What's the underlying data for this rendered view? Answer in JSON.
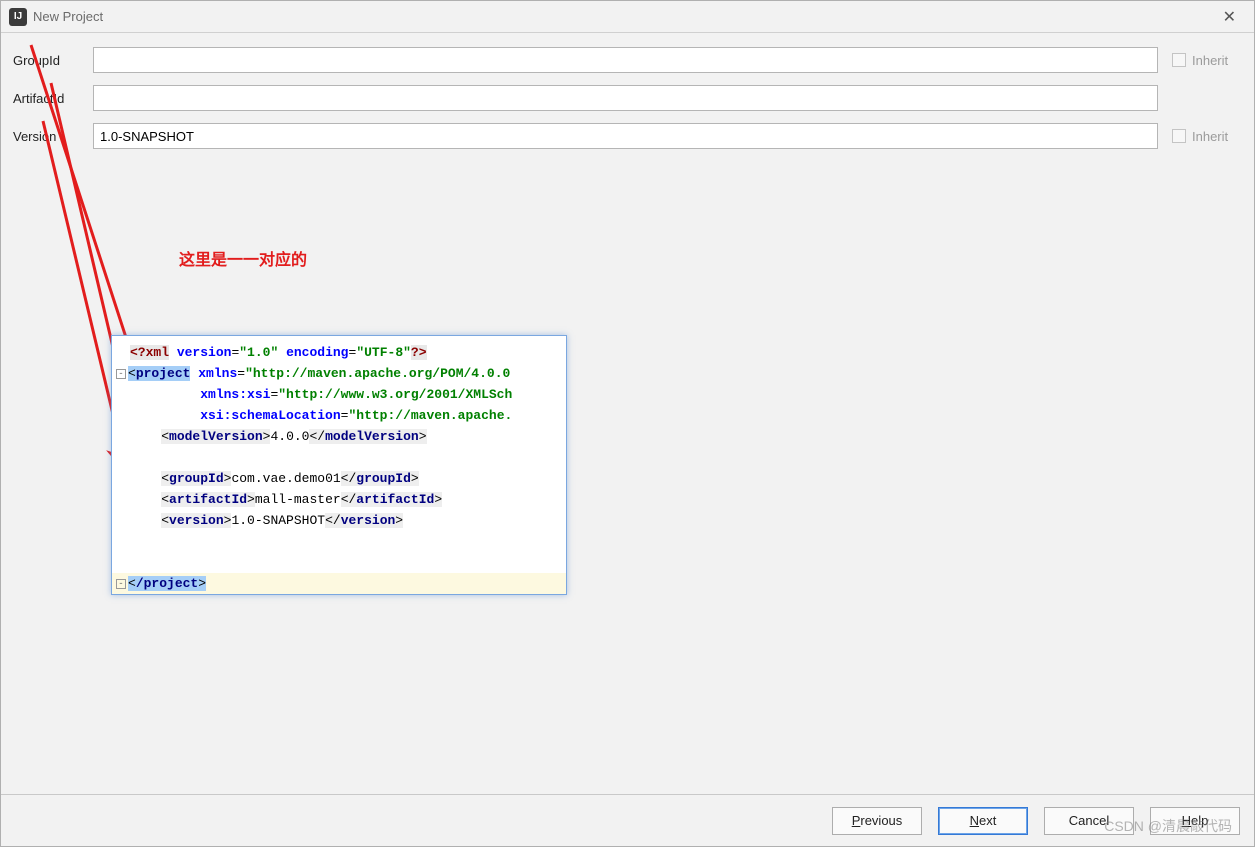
{
  "window": {
    "title": "New Project"
  },
  "form": {
    "groupId": {
      "label": "GroupId",
      "value": "",
      "inherit_label": "Inherit"
    },
    "artifactId": {
      "label": "ArtifactId",
      "value": ""
    },
    "version": {
      "label": "Version",
      "value": "1.0-SNAPSHOT",
      "inherit_label": "Inherit"
    }
  },
  "annotation": {
    "text": "这里是一一对应的"
  },
  "code": {
    "xml_decl": {
      "open": "<?xml",
      "version_k": "version",
      "version_v": "\"1.0\"",
      "encoding_k": "encoding",
      "encoding_v": "\"UTF-8\"",
      "close": "?>"
    },
    "project_open": "project",
    "xmlns_k": "xmlns",
    "xmlns_v": "\"http://maven.apache.org/POM/4.0.0",
    "xmlnsxsi_k": "xmlns:xsi",
    "xmlnsxsi_v": "\"http://www.w3.org/2001/XMLSch",
    "schemaloc_k": "xsi:schemaLocation",
    "schemaloc_v": "\"http://maven.apache.",
    "modelVersion_tag": "modelVersion",
    "modelVersion_val": "4.0.0",
    "groupId_tag": "groupId",
    "groupId_val": "com.vae.demo01",
    "artifactId_tag": "artifactId",
    "artifactId_val": "mall-master",
    "version_tag": "version",
    "version_val": "1.0-SNAPSHOT",
    "project_close": "/project"
  },
  "buttons": {
    "previous": "Previous",
    "next": "Next",
    "cancel": "Cancel",
    "help": "Help"
  },
  "watermark": "CSDN @清晨敲代码",
  "icons": {
    "app_glyph": "IJ"
  }
}
